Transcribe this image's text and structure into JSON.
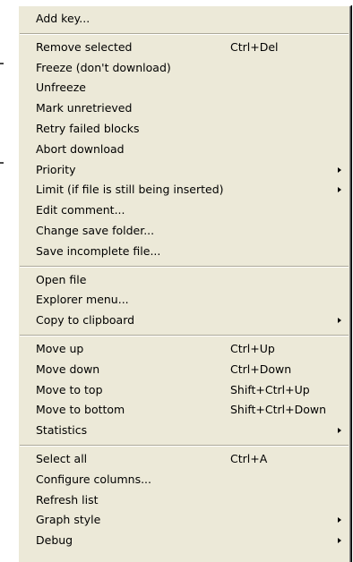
{
  "menu": {
    "group1": [
      {
        "label": "Add key...",
        "shortcut": "",
        "submenu": false
      }
    ],
    "group2": [
      {
        "label": "Remove selected",
        "shortcut": "Ctrl+Del",
        "submenu": false
      },
      {
        "label": "Freeze (don't download)",
        "shortcut": "",
        "submenu": false
      },
      {
        "label": "Unfreeze",
        "shortcut": "",
        "submenu": false
      },
      {
        "label": "Mark unretrieved",
        "shortcut": "",
        "submenu": false
      },
      {
        "label": "Retry failed blocks",
        "shortcut": "",
        "submenu": false
      },
      {
        "label": "Abort download",
        "shortcut": "",
        "submenu": false
      },
      {
        "label": "Priority",
        "shortcut": "",
        "submenu": true
      },
      {
        "label": "Limit (if file is still being inserted)",
        "shortcut": "",
        "submenu": true
      },
      {
        "label": "Edit comment...",
        "shortcut": "",
        "submenu": false
      },
      {
        "label": "Change save folder...",
        "shortcut": "",
        "submenu": false
      },
      {
        "label": "Save incomplete file...",
        "shortcut": "",
        "submenu": false
      }
    ],
    "group3": [
      {
        "label": "Open file",
        "shortcut": "",
        "submenu": false
      },
      {
        "label": "Explorer menu...",
        "shortcut": "",
        "submenu": false
      },
      {
        "label": "Copy to clipboard",
        "shortcut": "",
        "submenu": true
      }
    ],
    "group4": [
      {
        "label": "Move up",
        "shortcut": "Ctrl+Up",
        "submenu": false
      },
      {
        "label": "Move down",
        "shortcut": "Ctrl+Down",
        "submenu": false
      },
      {
        "label": "Move to top",
        "shortcut": "Shift+Ctrl+Up",
        "submenu": false
      },
      {
        "label": "Move to bottom",
        "shortcut": "Shift+Ctrl+Down",
        "submenu": false
      },
      {
        "label": "Statistics",
        "shortcut": "",
        "submenu": true
      }
    ],
    "group5": [
      {
        "label": "Select all",
        "shortcut": "Ctrl+A",
        "submenu": false
      },
      {
        "label": "Configure columns...",
        "shortcut": "",
        "submenu": false
      },
      {
        "label": "Refresh list",
        "shortcut": "",
        "submenu": false
      },
      {
        "label": "Graph style",
        "shortcut": "",
        "submenu": true
      },
      {
        "label": "Debug",
        "shortcut": "",
        "submenu": true
      }
    ]
  }
}
